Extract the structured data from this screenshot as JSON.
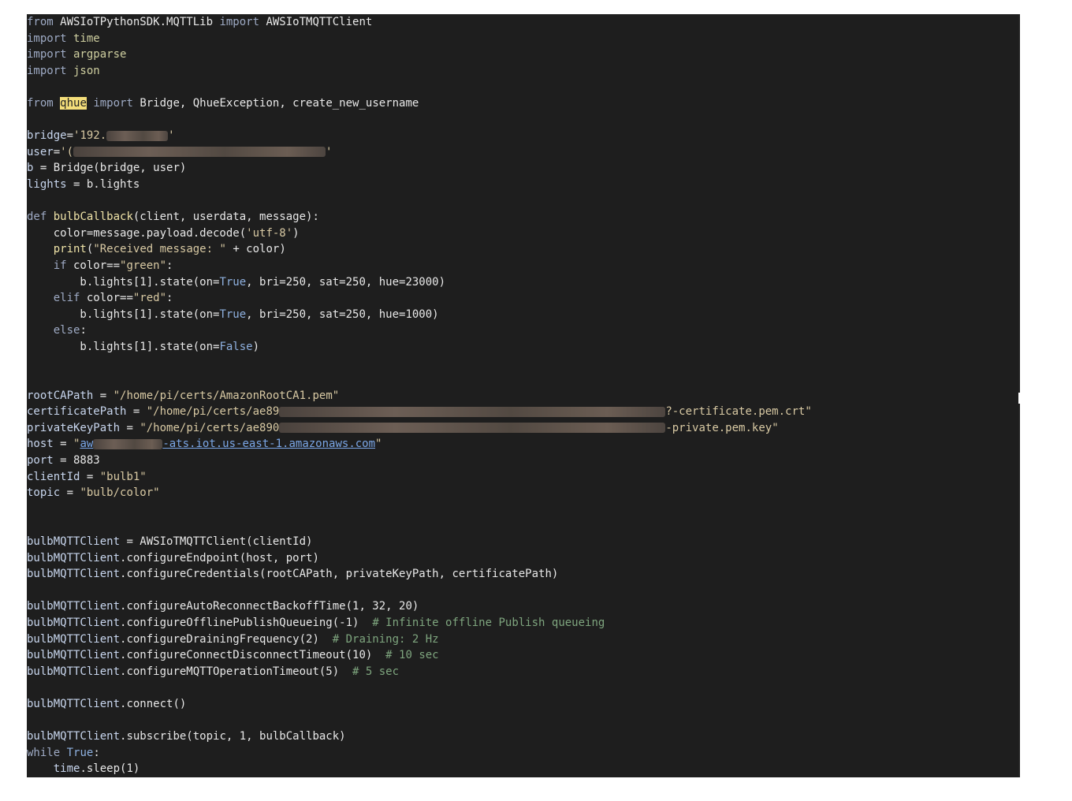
{
  "colors": {
    "background": "#1e1e1e",
    "text": "#e8e8e8",
    "keyword": "#9eaac4",
    "string": "#d8c9a3",
    "comment": "#7ea57e",
    "boolean": "#8fb1e0",
    "link": "#7aa6e6",
    "highlight": "#f3dd7a"
  },
  "editor": {
    "lines": [
      [
        [
          "kw",
          "from"
        ],
        [
          "t",
          " AWSIoTPythonSDK.MQTTLib "
        ],
        [
          "kw",
          "import"
        ],
        [
          "t",
          " AWSIoTMQTTClient"
        ]
      ],
      [
        [
          "kw",
          "import"
        ],
        [
          "mod",
          " time"
        ]
      ],
      [
        [
          "kw",
          "import"
        ],
        [
          "mod",
          " argparse"
        ]
      ],
      [
        [
          "kw",
          "import"
        ],
        [
          "mod",
          " json"
        ]
      ],
      [],
      [
        [
          "kw",
          "from"
        ],
        [
          "t",
          " "
        ],
        [
          "hl",
          "qhue"
        ],
        [
          "t",
          " "
        ],
        [
          "kw",
          "import"
        ],
        [
          "t",
          " Bridge, QhueException, create_new_username"
        ]
      ],
      [],
      [
        [
          "var",
          "bridge"
        ],
        [
          "t",
          "="
        ],
        [
          "str",
          "'192."
        ],
        [
          "redact",
          "",
          78
        ],
        [
          "str",
          "'"
        ]
      ],
      [
        [
          "var",
          "user"
        ],
        [
          "t",
          "="
        ],
        [
          "str",
          "'("
        ],
        [
          "redact",
          "",
          320
        ],
        [
          "str",
          "'"
        ]
      ],
      [
        [
          "var",
          "b"
        ],
        [
          "t",
          " = Bridge(bridge, user)"
        ]
      ],
      [
        [
          "var",
          "lights"
        ],
        [
          "t",
          " = b.lights"
        ]
      ],
      [],
      [
        [
          "kw",
          "def"
        ],
        [
          "fn",
          " bulbCallback"
        ],
        [
          "t",
          "(client, userdata, message):"
        ]
      ],
      [
        [
          "t",
          "    color=message.payload.decode("
        ],
        [
          "str",
          "'utf-8'"
        ],
        [
          "t",
          ")"
        ]
      ],
      [
        [
          "t",
          "    "
        ],
        [
          "fn",
          "print"
        ],
        [
          "t",
          "("
        ],
        [
          "str",
          "\"Received message: \""
        ],
        [
          "t",
          " + color)"
        ]
      ],
      [
        [
          "t",
          "    "
        ],
        [
          "kw",
          "if"
        ],
        [
          "t",
          " color=="
        ],
        [
          "str",
          "\"green\""
        ],
        [
          "t",
          ":"
        ]
      ],
      [
        [
          "t",
          "        b.lights[1].state(on="
        ],
        [
          "bool",
          "True"
        ],
        [
          "t",
          ", bri=250, sat=250, hue=23000)"
        ]
      ],
      [
        [
          "t",
          "    "
        ],
        [
          "kw",
          "elif"
        ],
        [
          "t",
          " color=="
        ],
        [
          "str",
          "\"red\""
        ],
        [
          "t",
          ":"
        ]
      ],
      [
        [
          "t",
          "        b.lights[1].state(on="
        ],
        [
          "bool",
          "True"
        ],
        [
          "t",
          ", bri=250, sat=250, hue=1000)"
        ]
      ],
      [
        [
          "t",
          "    "
        ],
        [
          "kw",
          "else"
        ],
        [
          "t",
          ":"
        ]
      ],
      [
        [
          "t",
          "        b.lights[1].state(on="
        ],
        [
          "bool",
          "False"
        ],
        [
          "t",
          ")"
        ]
      ],
      [],
      [],
      [
        [
          "var",
          "rootCAPath"
        ],
        [
          "t",
          " = "
        ],
        [
          "str",
          "\"/home/pi/certs/AmazonRootCA1.pem\""
        ]
      ],
      [
        [
          "var",
          "certificatePath"
        ],
        [
          "t",
          " = "
        ],
        [
          "str",
          "\"/home/pi/certs/ae89"
        ],
        [
          "redact",
          "",
          490
        ],
        [
          "str",
          "?-certificate.pem.crt\""
        ]
      ],
      [
        [
          "var",
          "privateKeyPath"
        ],
        [
          "t",
          " = "
        ],
        [
          "str",
          "\"/home/pi/certs/ae890"
        ],
        [
          "redact",
          "",
          490
        ],
        [
          "str",
          "-private.pem.key\""
        ]
      ],
      [
        [
          "var",
          "host"
        ],
        [
          "t",
          " = "
        ],
        [
          "str",
          "\""
        ],
        [
          "link",
          "aw"
        ],
        [
          "redact",
          "",
          88
        ],
        [
          "link",
          "-ats.iot.us-east-1.amazonaws.com"
        ],
        [
          "str",
          "\""
        ]
      ],
      [
        [
          "var",
          "port"
        ],
        [
          "t",
          " = 8883"
        ]
      ],
      [
        [
          "var",
          "clientId"
        ],
        [
          "t",
          " = "
        ],
        [
          "str",
          "\"bulb1\""
        ]
      ],
      [
        [
          "var",
          "topic"
        ],
        [
          "t",
          " = "
        ],
        [
          "str",
          "\"bulb/color\""
        ]
      ],
      [],
      [],
      [
        [
          "var",
          "bulbMQTTClient"
        ],
        [
          "t",
          " = AWSIoTMQTTClient(clientId)"
        ]
      ],
      [
        [
          "var",
          "bulbMQTTClient"
        ],
        [
          "t",
          ".configureEndpoint(host, port)"
        ]
      ],
      [
        [
          "var",
          "bulbMQTTClient"
        ],
        [
          "t",
          ".configureCredentials(rootCAPath, privateKeyPath, certificatePath)"
        ]
      ],
      [],
      [
        [
          "var",
          "bulbMQTTClient"
        ],
        [
          "t",
          ".configureAutoReconnectBackoffTime(1, 32, 20)"
        ]
      ],
      [
        [
          "var",
          "bulbMQTTClient"
        ],
        [
          "t",
          ".configureOfflinePublishQueueing(-1)  "
        ],
        [
          "cm",
          "# Infinite offline Publish queueing"
        ]
      ],
      [
        [
          "var",
          "bulbMQTTClient"
        ],
        [
          "t",
          ".configureDrainingFrequency(2)  "
        ],
        [
          "cm",
          "# Draining: 2 Hz"
        ]
      ],
      [
        [
          "var",
          "bulbMQTTClient"
        ],
        [
          "t",
          ".configureConnectDisconnectTimeout(10)  "
        ],
        [
          "cm",
          "# 10 sec"
        ]
      ],
      [
        [
          "var",
          "bulbMQTTClient"
        ],
        [
          "t",
          ".configureMQTTOperationTimeout(5)  "
        ],
        [
          "cm",
          "# 5 sec"
        ]
      ],
      [],
      [
        [
          "var",
          "bulbMQTTClient"
        ],
        [
          "t",
          ".connect()"
        ]
      ],
      [],
      [
        [
          "var",
          "bulbMQTTClient"
        ],
        [
          "t",
          ".subscribe(topic, 1, bulbCallback)"
        ]
      ],
      [
        [
          "kw",
          "while"
        ],
        [
          "bool",
          " True"
        ],
        [
          "t",
          ":"
        ]
      ],
      [
        [
          "t",
          "    "
        ],
        [
          "var",
          "time"
        ],
        [
          "t",
          ".sleep(1)"
        ]
      ]
    ]
  }
}
